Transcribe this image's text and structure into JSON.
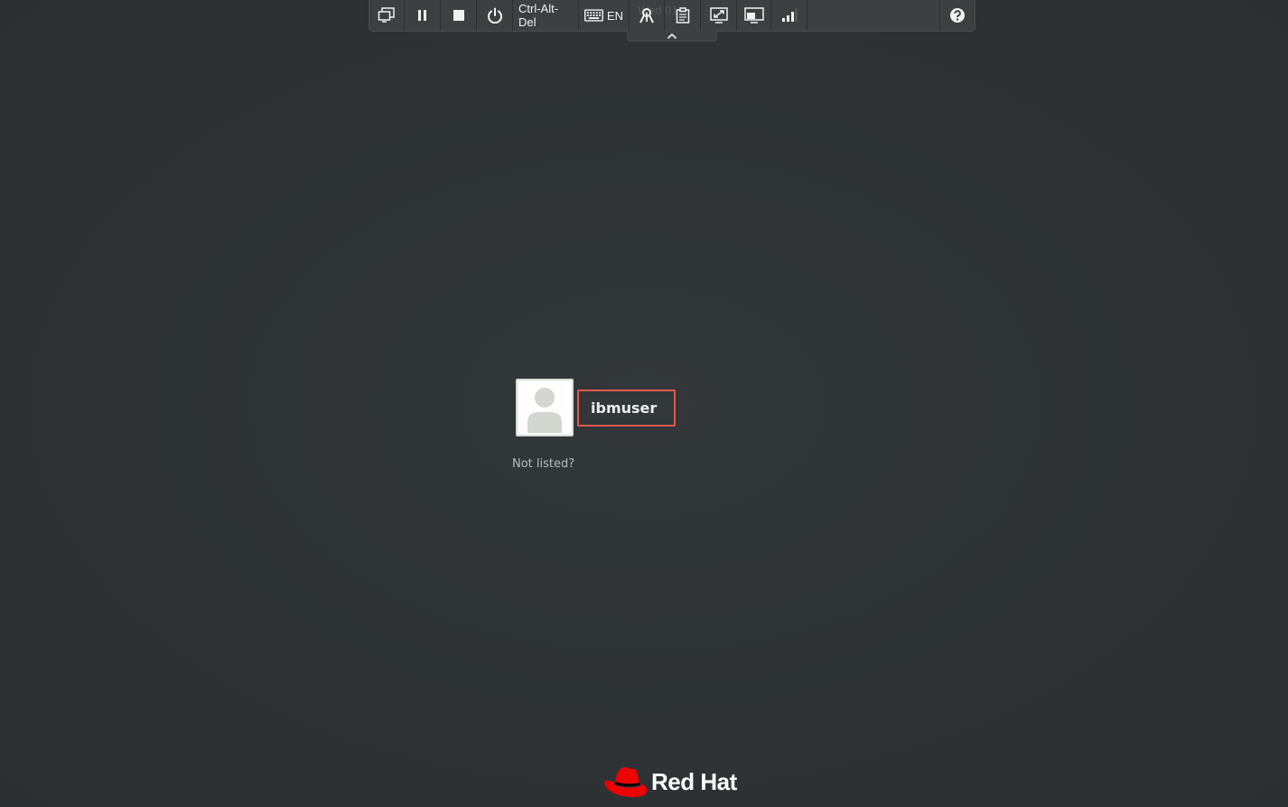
{
  "toolbar": {
    "buttons": [
      {
        "name": "monitors-icon"
      },
      {
        "name": "pause-icon"
      },
      {
        "name": "stop-icon"
      },
      {
        "name": "power-icon"
      },
      {
        "name": "ctrl-alt-del",
        "label": "Ctrl-Alt-Del"
      },
      {
        "name": "keyboard-icon",
        "label": "EN"
      },
      {
        "name": "key-icon"
      },
      {
        "name": "clipboard-icon"
      },
      {
        "name": "resize-icon"
      },
      {
        "name": "display-icon"
      },
      {
        "name": "signal-icon"
      },
      {
        "name": "help-icon"
      }
    ],
    "ctrl_alt_del_label": "Ctrl-Alt-Del",
    "keyboard_label": "EN",
    "ghost_clock": "Wed 01"
  },
  "login": {
    "username": "ibmuser",
    "not_listed": "Not listed?"
  },
  "brand": {
    "name": "Red Hat",
    "color": "#ee0000"
  },
  "colors": {
    "background": "#2f3335",
    "highlight": "#e05a4f",
    "toolbar": "#3d3f41"
  }
}
